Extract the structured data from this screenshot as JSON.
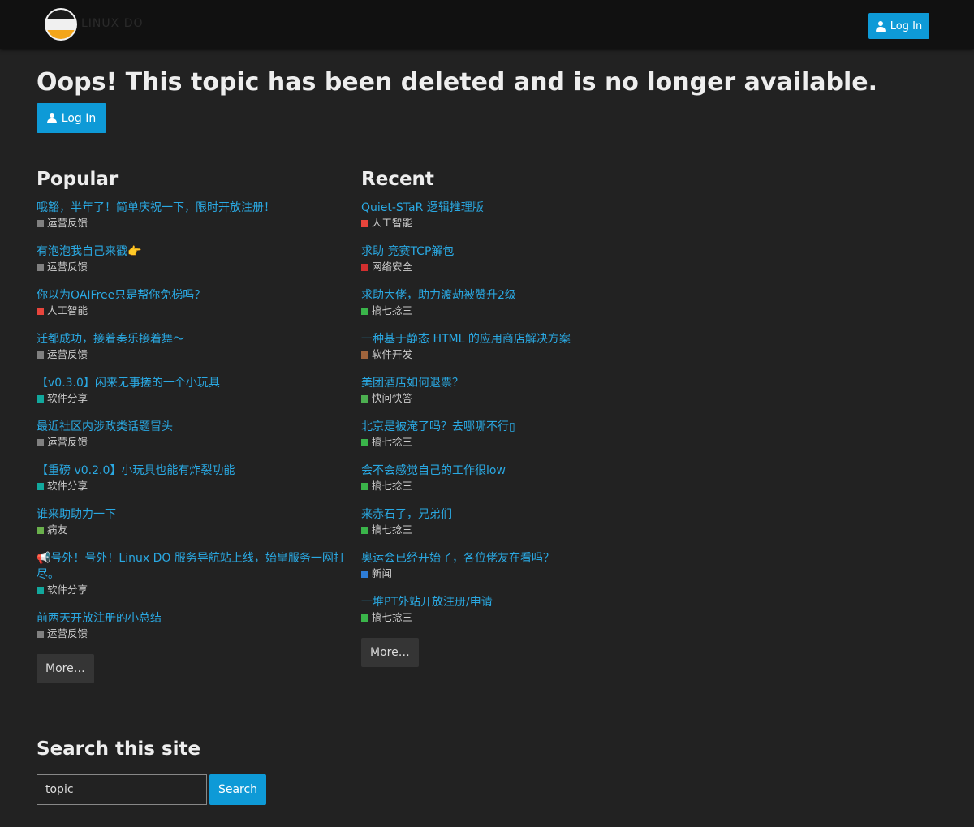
{
  "header": {
    "logo_text": "LINUX DO",
    "login_label": "Log In"
  },
  "page": {
    "title": "Oops! This topic has been deleted and is no longer available.",
    "login_label": "Log In"
  },
  "popular": {
    "heading": "Popular",
    "more_label": "More…",
    "topics": [
      {
        "title": "哦豁，半年了！简单庆祝一下，限时开放注册！",
        "category": "运营反馈",
        "color": "#808080"
      },
      {
        "title": "有泡泡我自己来戳👉",
        "category": "运营反馈",
        "color": "#808080"
      },
      {
        "title": "你以为OAIFree只是帮你免梯吗？",
        "category": "人工智能",
        "color": "#e8453c"
      },
      {
        "title": "迁都成功，接着奏乐接着舞～",
        "category": "运营反馈",
        "color": "#808080"
      },
      {
        "title": "【v0.3.0】闲来无事搓的一个小玩具",
        "category": "软件分享",
        "color": "#12a89d"
      },
      {
        "title": "最近社区内涉政类话题冒头",
        "category": "运营反馈",
        "color": "#808080"
      },
      {
        "title": "【重磅 v0.2.0】小玩具也能有炸裂功能",
        "category": "软件分享",
        "color": "#12a89d"
      },
      {
        "title": "谁来助助力一下",
        "category": "病友",
        "color": "#6ab04c"
      },
      {
        "title": "📢号外！号外！Linux DO 服务导航站上线，始皇服务一网打尽。",
        "category": "软件分享",
        "color": "#12a89d"
      },
      {
        "title": "前两天开放注册的小总结",
        "category": "运营反馈",
        "color": "#808080"
      }
    ]
  },
  "recent": {
    "heading": "Recent",
    "more_label": "More…",
    "topics": [
      {
        "title": "Quiet-STaR 逻辑推理版",
        "category": "人工智能",
        "color": "#e8453c"
      },
      {
        "title": "求助 竞赛TCP解包",
        "category": "网络安全",
        "color": "#d32f2f"
      },
      {
        "title": "求助大佬，助力渡劫被赞升2级",
        "category": "搞七捻三",
        "color": "#3ab54a"
      },
      {
        "title": "一种基于静态 HTML 的应用商店解决方案",
        "category": "软件开发",
        "color": "#a0643c"
      },
      {
        "title": "美团酒店如何退票？",
        "category": "快问快答",
        "color": "#4caf50"
      },
      {
        "title": "北京是被淹了吗？去哪哪不行▯",
        "category": "搞七捻三",
        "color": "#3ab54a"
      },
      {
        "title": "会不会感觉自己的工作很low",
        "category": "搞七捻三",
        "color": "#3ab54a"
      },
      {
        "title": "来赤石了，兄弟们",
        "category": "搞七捻三",
        "color": "#3ab54a"
      },
      {
        "title": "奥运会已经开始了，各位佬友在看吗？",
        "category": "新闻",
        "color": "#2e7dd7"
      },
      {
        "title": "一堆PT外站开放注册/申请",
        "category": "搞七捻三",
        "color": "#3ab54a"
      }
    ]
  },
  "search": {
    "heading": "Search this site",
    "value": "topic",
    "button_label": "Search"
  }
}
